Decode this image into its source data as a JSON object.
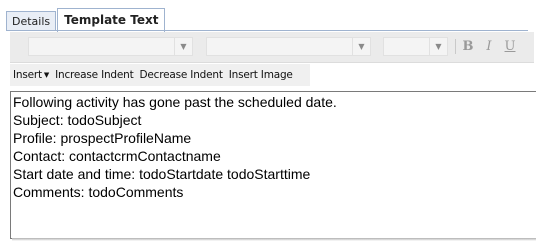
{
  "tabs": [
    {
      "label": "Details",
      "active": false
    },
    {
      "label": "Template Text",
      "active": true
    }
  ],
  "format_bar": {
    "font_name_value": "",
    "font_style_value": "",
    "font_size_value": "",
    "bold_label": "B",
    "italic_label": "I",
    "underline_label": "U"
  },
  "toolbar": {
    "insert_label": "Insert",
    "increase_indent_label": "Increase Indent",
    "decrease_indent_label": "Decrease Indent",
    "insert_image_label": "Insert Image"
  },
  "editor": {
    "lines": [
      "Following activity has gone past the scheduled date.",
      "Subject: todoSubject",
      "Profile: prospectProfileName",
      "Contact: contactcrmContactname",
      "Start date and time: todoStartdate todoStarttime",
      "Comments: todoComments"
    ]
  }
}
